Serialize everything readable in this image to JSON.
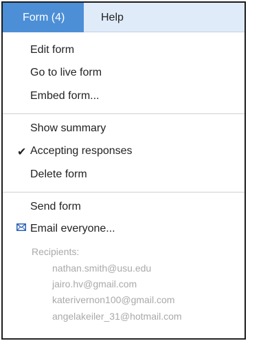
{
  "menubar": {
    "form_tab": "Form (4)",
    "help_tab": "Help"
  },
  "menu": {
    "edit_form": "Edit form",
    "go_to_live_form": "Go to live form",
    "embed_form": "Embed form...",
    "show_summary": "Show summary",
    "accepting_responses": "Accepting responses",
    "accepting_responses_checked": true,
    "check_mark": "✔",
    "delete_form": "Delete form",
    "send_form": "Send form",
    "email_everyone": "Email everyone..."
  },
  "recipients": {
    "label": "Recipients:",
    "list": [
      "nathan.smith@usu.edu",
      "jairo.hv@gmail.com",
      "katerivernon100@gmail.com",
      "angelakeiler_31@hotmail.com"
    ]
  },
  "colors": {
    "active_tab": "#4c8fd6",
    "menubar_bg": "#e0ebf9",
    "mail_icon": "#2a62b5",
    "disabled_text": "#a9a9a9"
  },
  "icons": {
    "check": "check-icon",
    "mail": "mail-icon"
  }
}
